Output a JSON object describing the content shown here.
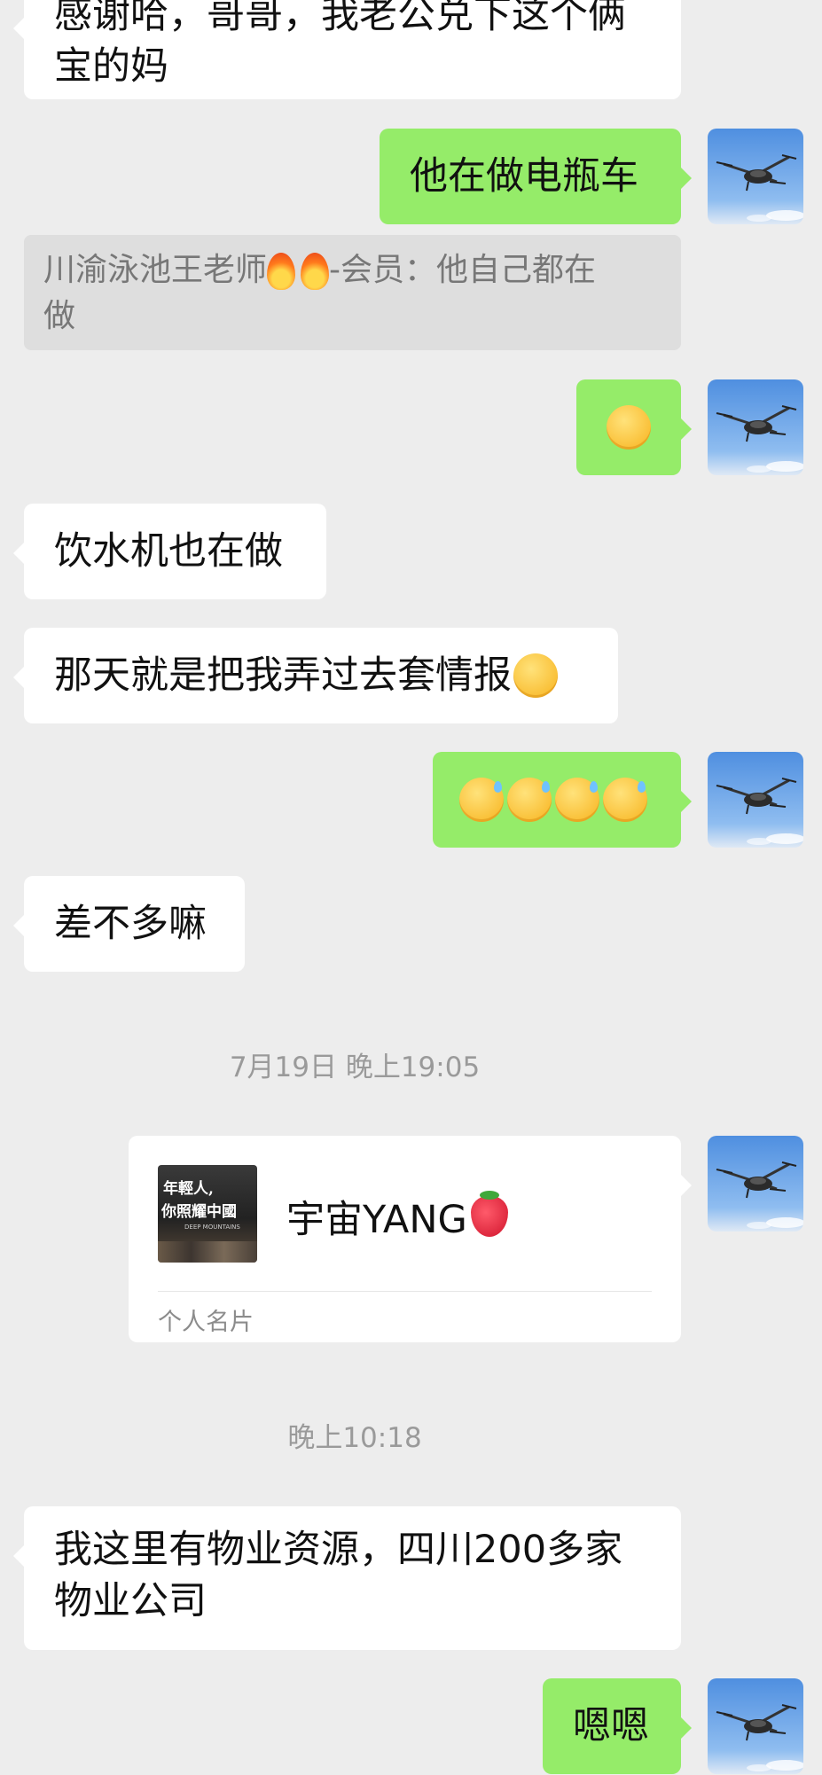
{
  "messages": {
    "m0_line1": "感谢哈，哥哥，我老公兑下这个俩",
    "m0_line2": "宝的妈",
    "m1": "他在做电瓶车",
    "quote_text": "川渝泳池王老师",
    "quote_suffix": "-会员：他自己都在",
    "quote_line2": "做",
    "m3": "饮水机也在做",
    "m4": "那天就是把我弄过去套情报",
    "m6": "差不多嘛",
    "m8_line1": "我这里有物业资源，四川200多家",
    "m8_line2": "物业公司",
    "m9": "嗯嗯"
  },
  "timestamps": {
    "t1": "7月19日 晚上19:05",
    "t2": "晚上10:18"
  },
  "card": {
    "name": "宇宙YANG",
    "label": "个人名片",
    "thumb_line1": "年輕人,",
    "thumb_line2": "你照耀中國",
    "thumb_line3": "DEEP MOUNTAINS"
  },
  "emojis": {
    "fire": "fire-icon",
    "hand_over_mouth": "face-hand-over-mouth-icon",
    "crying_laughing": "rolling-laughing-icon",
    "downcast_sweat": "downcast-sweat-icon",
    "strawberry": "strawberry-icon"
  },
  "colors": {
    "background": "#ededed",
    "sent_bubble": "#95ec69",
    "received_bubble": "#ffffff",
    "quote_bg": "#dedede"
  }
}
